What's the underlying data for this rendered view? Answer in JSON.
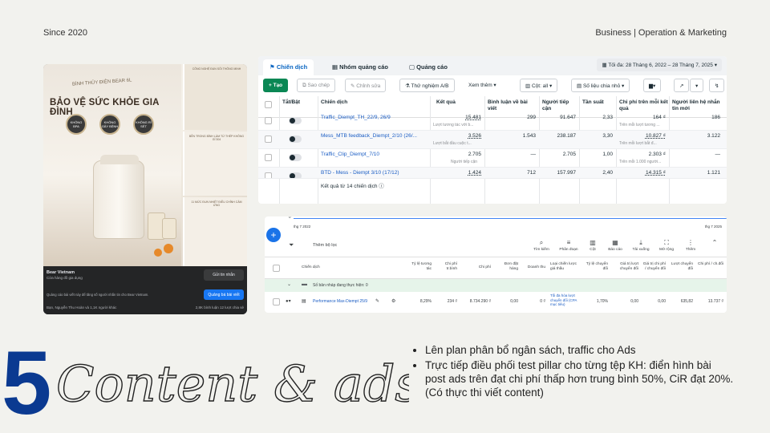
{
  "header": {
    "since": "Since 2020",
    "tagline": "Business | Operation & Marketing"
  },
  "ad_preview": {
    "small_title": "BÌNH THỦY ĐIỆN BEAR 6L",
    "headline": "BẢO VỆ SỨC KHỎE GIA ĐÌNH",
    "badges": [
      "KHÔNG BPA",
      "KHÔNG GÂY BỆNH",
      "KHÔNG RỈ SÉT"
    ],
    "strip_texts": [
      "CÔNG NGHỆ ĐUN SÔI THÔNG MINH",
      "BỀN TRONG BÌNH LÀM TỪ THÉP KHÔNG GỈ 304",
      "11 MỨC ĐUN NHIỆT ĐIỀU CHỈNH CẢM ỨNG"
    ],
    "brand": "Bear Vietnam",
    "brand_sub": "Cửa hàng đồ gia dụng",
    "message_button": "Gửi tin nhắn",
    "promo_text": "Quảng cáo bài viết này để tăng số người nhắn tin cho Bear Vietnam.",
    "boost_button": "Quảng bá bài viết",
    "reactions": "Bạn, Nguyễn Thu Hoàn và 1,1K người khác",
    "stats": "2,8K bình luận   12 lượt chia sẻ"
  },
  "ads_manager": {
    "tabs": [
      "Chiến dịch",
      "Nhóm quảng cáo",
      "Quảng cáo"
    ],
    "date_range": "Tối đa: 28 Tháng 6, 2022 – 28 Tháng 7, 2025",
    "toolbar": {
      "create": "+ Tạo",
      "copy": "Sao chép",
      "edit": "Chỉnh sửa",
      "ab_test": "Thử nghiệm A/B",
      "more": "Xem thêm",
      "columns": "Cột: all",
      "breakdown": "Số liệu chia nhỏ"
    },
    "columns": [
      "Tắt/Bật",
      "Chiến dịch",
      "Kết quả",
      "Bình luận về bài viết",
      "Người tiếp cận",
      "Tần suất",
      "Chi phí trên mỗi kết quả",
      "Người liên hệ nhắn tin mới"
    ],
    "rows": [
      {
        "name": "Traffic_Diempt_TH_22/9, 26/9",
        "result": "15.481",
        "result_sub": "Lượt tương tác với b...",
        "comments": "299",
        "reach": "91.647",
        "freq": "2,33",
        "cpr": "164 ₫",
        "cpr_sub": "Trên mỗi lượt tương ...",
        "contacts": "186"
      },
      {
        "name": "Mess_MTB feedback_Diempt_2/10 (26/...",
        "result": "3.526",
        "result_sub": "Lượt bắt đầu cuộc t...",
        "comments": "1.543",
        "reach": "238.187",
        "freq": "3,30",
        "cpr": "10.827 ₫",
        "cpr_sub": "Trên mỗi lượt bắt đ...",
        "contacts": "3.122"
      },
      {
        "name": "Traffic_Clip_Diempt_7/10",
        "result": "2.705",
        "result_sub": "Người tiếp cận",
        "comments": "—",
        "reach": "2.705",
        "freq": "1,00",
        "cpr": "2.303 ₫",
        "cpr_sub": "Trên mỗi 1.000 người...",
        "contacts": "—"
      },
      {
        "name": "BTD - Mess - Diempt 3/10 (17/12)",
        "result": "1.424",
        "result_sub": "",
        "comments": "712",
        "reach": "157.997",
        "freq": "2,40",
        "cpr": "14.315 ₫",
        "cpr_sub": "",
        "contacts": "1.121"
      }
    ],
    "total": "Kết quả từ 14 chiến dịch"
  },
  "google_ads": {
    "axis_start": "thg 7 2022",
    "axis_end": "thg 7 2025",
    "axis_zero": "0",
    "filter": "Thêm bộ lọc",
    "tools": [
      "Tìm kiếm",
      "Phân đoạn",
      "Cột",
      "Báo cáo",
      "Tải xuống",
      "Mở rộng",
      "Thêm"
    ],
    "columns": [
      "Chiến dịch",
      "Tỷ lệ tương tác",
      "Chi phí tr.bình",
      "Chi phí",
      "Đơn đặt hàng",
      "Doanh thu",
      "Loại chiến lược giá thầu",
      "Tỷ lệ chuyển đổi",
      "Giá trị lượt chuyển đổi",
      "Giá trị chi phí / chuyển đổi",
      "Lượt chuyển đổi",
      "Chi phí / ch.đổi"
    ],
    "group": "Số bản nháp đang thực hiện: 0",
    "row": {
      "name": "Performance Max-Diempt 25/9",
      "ctr": "8,29%",
      "avg_cost": "234 ₫",
      "cost": "8.734.290 ₫",
      "orders": "0,00",
      "revenue": "0 ₫",
      "bid": "Tối đa hóa lượt chuyển đổi (CPA mục tiêu)",
      "conv_rate": "1,70%",
      "conv_value": "0,00",
      "value_cost": "0,00",
      "conversions": "635,82",
      "cost_conv": "13.737 ₫"
    }
  },
  "section": {
    "number": "5",
    "script_title": "Content & ads",
    "bullets": [
      "Lên plan phân bổ ngân sách, traffic cho Ads",
      "Trực tiếp điều phối test pillar cho từng tệp KH: điển hình bài post ads trên đạt chi phí thấp hơn trung bình 50%, CiR đạt 20%. (Có thực thi viết content)"
    ]
  },
  "colors": {
    "accent_blue": "#0b3a91",
    "fb_blue": "#1877f2",
    "create_green": "#0a8754"
  }
}
